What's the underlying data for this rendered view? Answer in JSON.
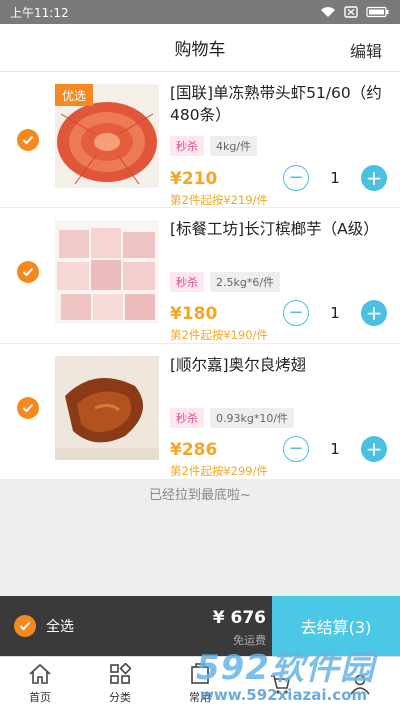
{
  "status_bar": {
    "time": "上午11:12"
  },
  "header": {
    "title": "购物车",
    "edit_label": "编辑"
  },
  "cart_items": [
    {
      "name": "[国联]单冻熟带头虾51/60（约480条）",
      "tag": "优选",
      "promo_badge": "秒杀",
      "spec": "4kg/件",
      "price": "¥210",
      "tier_price": "第2件起按¥219/件",
      "quantity": "1"
    },
    {
      "name": "[标餐工坊]长汀槟榔芋（A级）",
      "tag": "",
      "promo_badge": "秒杀",
      "spec": "2.5kg*6/件",
      "price": "¥180",
      "tier_price": "第2件起按¥190/件",
      "quantity": "1"
    },
    {
      "name": "[顺尔嘉]奥尔良烤翅",
      "tag": "",
      "promo_badge": "秒杀",
      "spec": "0.93kg*10/件",
      "price": "¥286",
      "tier_price": "第2件起按¥299/件",
      "quantity": "1"
    }
  ],
  "list_end_tip": "已经拉到最底啦~",
  "checkout": {
    "select_all_label": "全选",
    "total": "¥ 676",
    "freight": "免运费",
    "checkout_label": "去结算(3)"
  },
  "tabbar": [
    {
      "label": "首页",
      "icon": "home-icon"
    },
    {
      "label": "分类",
      "icon": "category-icon"
    },
    {
      "label": "常用",
      "icon": "favorites-icon"
    }
  ],
  "watermark": {
    "brand": "592软件园",
    "url": "www.592xiazai.com"
  },
  "colors": {
    "accent_orange": "#f5891f",
    "price": "#f5a623",
    "cyan": "#4bc8e6",
    "dark_bar": "#3a3a3a"
  }
}
